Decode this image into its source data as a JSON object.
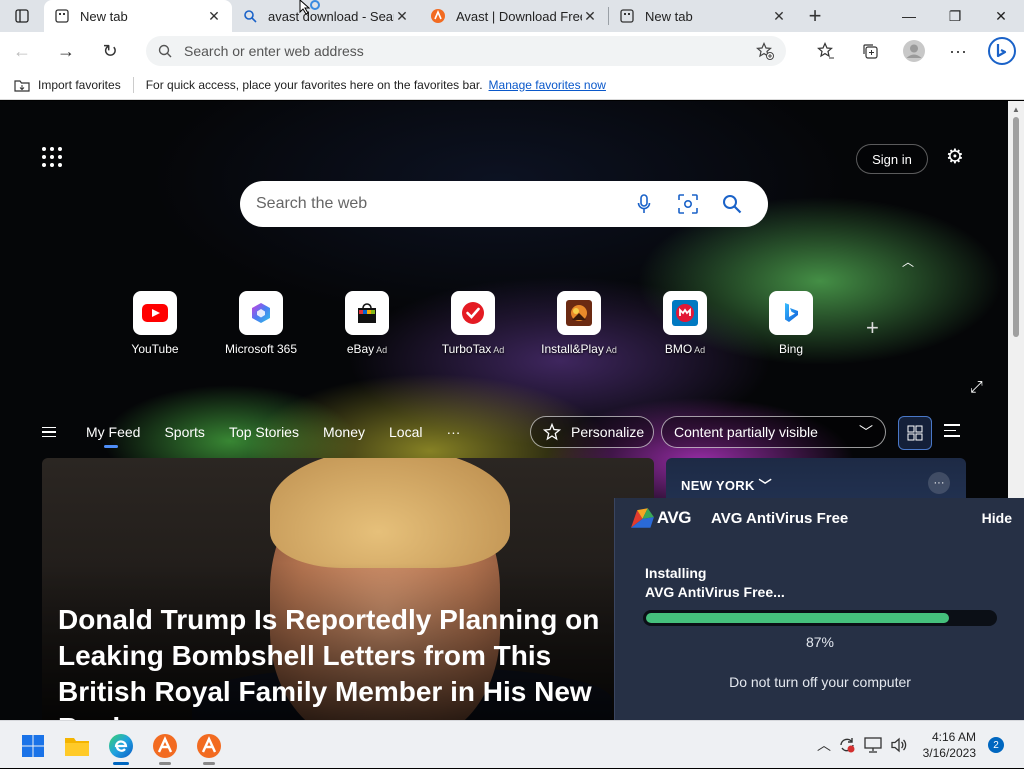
{
  "browser": {
    "tabs": [
      {
        "label": "New tab",
        "icon": "new-tab-icon",
        "active": true
      },
      {
        "label": "avast download - Search",
        "icon": "search-icon",
        "active": false
      },
      {
        "label": "Avast | Download Free A",
        "icon": "avast-icon",
        "active": false
      },
      {
        "label": "New tab",
        "icon": "new-tab-icon",
        "active": false
      }
    ],
    "address": {
      "placeholder": "Search or enter web address",
      "value": ""
    },
    "favorites_bar": {
      "import_label": "Import favorites",
      "hint": "For quick access, place your favorites here on the favorites bar.",
      "manage_link": "Manage favorites now"
    }
  },
  "newtab": {
    "signin_label": "Sign in",
    "search_placeholder": "Search the web",
    "tiles": [
      {
        "name": "YouTube",
        "ad": ""
      },
      {
        "name": "Microsoft 365",
        "ad": ""
      },
      {
        "name": "eBay",
        "ad": "Ad"
      },
      {
        "name": "TurboTax",
        "ad": "Ad"
      },
      {
        "name": "Install&Play",
        "ad": "Ad"
      },
      {
        "name": "BMO",
        "ad": "Ad"
      },
      {
        "name": "Bing",
        "ad": ""
      }
    ],
    "feed_tabs": [
      "My Feed",
      "Sports",
      "Top Stories",
      "Money",
      "Local"
    ],
    "more_label": "···",
    "personalize_label": "Personalize",
    "content_dropdown": "Content partially visible",
    "hero_headline": "Donald Trump Is Reportedly Planning on Leaking Bombshell Letters from This British Royal Family Member in His New Book",
    "weather_city": "NEW YORK"
  },
  "avg_popup": {
    "brand": "AVG",
    "title": "AVG AntiVirus Free",
    "hide_label": "Hide",
    "status_line1": "Installing",
    "status_line2": "AVG AntiVirus Free...",
    "progress_percent": 87,
    "progress_label": "87%",
    "warning": "Do not turn off your computer",
    "accent_color": "#45c07c"
  },
  "taskbar": {
    "time": "4:16 AM",
    "date": "3/16/2023",
    "notification_count": "2"
  }
}
